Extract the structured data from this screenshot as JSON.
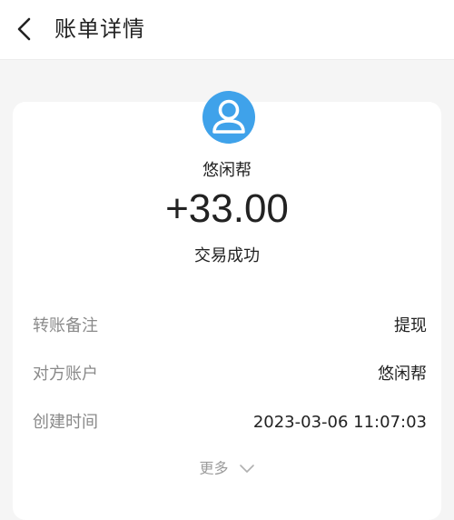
{
  "header": {
    "title": "账单详情"
  },
  "payee": {
    "name": "悠闲帮",
    "amount": "+33.00",
    "status": "交易成功"
  },
  "details": [
    {
      "label": "转账备注",
      "value": "提现"
    },
    {
      "label": "对方账户",
      "value": "悠闲帮"
    },
    {
      "label": "创建时间",
      "value": "2023-03-06 11:07:03"
    }
  ],
  "more": {
    "label": "更多"
  },
  "colors": {
    "avatar": "#3fa2ea",
    "label": "#8a8a8a",
    "text": "#222222"
  }
}
